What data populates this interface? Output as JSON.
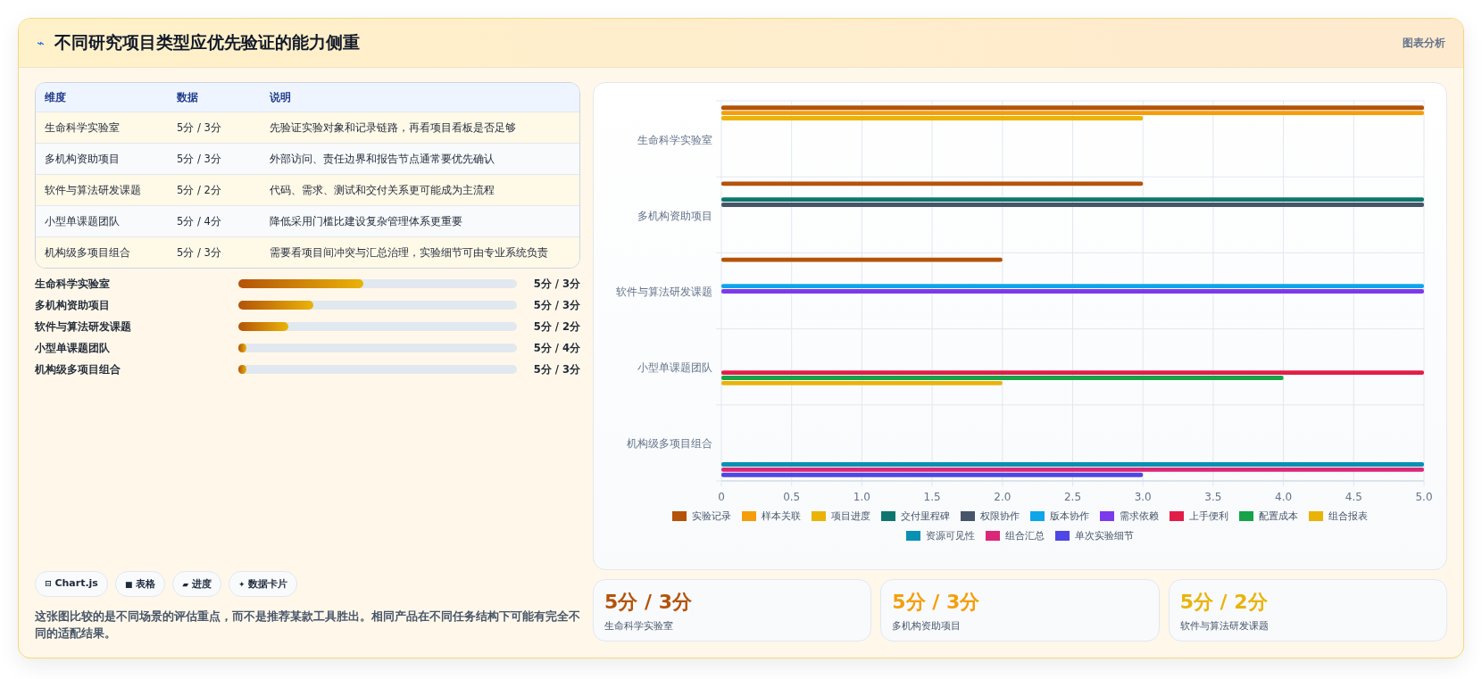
{
  "header": {
    "icon": "⌁",
    "title": "不同研究项目类型应优先验证的能力侧重",
    "tag": "图表分析"
  },
  "table": {
    "columns": [
      "维度",
      "数据",
      "说明"
    ],
    "rows": [
      [
        "生命科学实验室",
        "5分 / 3分",
        "先验证实验对象和记录链路，再看项目看板是否足够"
      ],
      [
        "多机构资助项目",
        "5分 / 3分",
        "外部访问、责任边界和报告节点通常要优先确认"
      ],
      [
        "软件与算法研发课题",
        "5分 / 2分",
        "代码、需求、测试和交付关系更可能成为主流程"
      ],
      [
        "小型单课题团队",
        "5分 / 4分",
        "降低采用门槛比建设复杂管理体系更重要"
      ],
      [
        "机构级多项目组合",
        "5分 / 3分",
        "需要看项目间冲突与汇总治理，实验细节可由专业系统负责"
      ]
    ]
  },
  "progress": [
    {
      "label": "生命科学实验室",
      "level": 0.45,
      "reading": "5分 / 3分"
    },
    {
      "label": "多机构资助项目",
      "level": 0.27,
      "reading": "5分 / 3分"
    },
    {
      "label": "软件与算法研发课题",
      "level": 0.18,
      "reading": "5分 / 2分"
    },
    {
      "label": "小型单课题团队",
      "level": 0.03,
      "reading": "5分 / 4分"
    },
    {
      "label": "机构级多项目组合",
      "level": 0.03,
      "reading": "5分 / 3分"
    }
  ],
  "chips": [
    {
      "icon": "⊟",
      "label": "Chart.js"
    },
    {
      "icon": "■",
      "label": "表格"
    },
    {
      "icon": "▰",
      "label": "进度"
    },
    {
      "icon": "✦",
      "label": "数据卡片"
    }
  ],
  "note": "这张图比较的是不同场景的评估重点，而不是推荐某款工具胜出。相同产品在不同任务结构下可能有完全不同的适配结果。",
  "chart": {
    "chart_data": {
      "type": "bar",
      "orientation": "horizontal",
      "categories": [
        "生命科学实验室",
        "多机构资助项目",
        "软件与算法研发课题",
        "小型单课题团队",
        "机构级多项目组合"
      ],
      "xlim": [
        0,
        5
      ],
      "grid": true,
      "xticks": [
        {
          "value": 0,
          "label": "0"
        },
        {
          "value": 0.5,
          "label": "0.5"
        },
        {
          "value": 1,
          "label": "1.0"
        },
        {
          "value": 1.5,
          "label": "1.5"
        },
        {
          "value": 2,
          "label": "2.0"
        },
        {
          "value": 2.5,
          "label": "2.5"
        },
        {
          "value": 3,
          "label": "3.0"
        },
        {
          "value": 3.5,
          "label": "3.5"
        },
        {
          "value": 4,
          "label": "4.0"
        },
        {
          "value": 4.5,
          "label": "4.5"
        },
        {
          "value": 5,
          "label": "5.0"
        }
      ],
      "series": [
        {
          "name": "实验记录",
          "color": "#b45309",
          "values": [
            5,
            3,
            2,
            null,
            null
          ]
        },
        {
          "name": "样本关联",
          "color": "#f59e0b",
          "values": [
            5,
            null,
            null,
            null,
            null
          ]
        },
        {
          "name": "项目进度",
          "color": "#eab308",
          "values": [
            3,
            null,
            null,
            null,
            null
          ]
        },
        {
          "name": "交付里程碑",
          "color": "#0f766e",
          "values": [
            null,
            5,
            null,
            null,
            null
          ]
        },
        {
          "name": "权限协作",
          "color": "#475569",
          "values": [
            null,
            5,
            null,
            null,
            null
          ]
        },
        {
          "name": "版本协作",
          "color": "#0ea5e9",
          "values": [
            null,
            null,
            5,
            null,
            null
          ]
        },
        {
          "name": "需求依赖",
          "color": "#7c3aed",
          "values": [
            null,
            null,
            5,
            null,
            null
          ]
        },
        {
          "name": "上手便利",
          "color": "#e11d48",
          "values": [
            null,
            null,
            null,
            5,
            null
          ]
        },
        {
          "name": "配置成本",
          "color": "#16a34a",
          "values": [
            null,
            null,
            null,
            4,
            null
          ]
        },
        {
          "name": "组合报表",
          "color": "#eab308",
          "values": [
            null,
            null,
            null,
            2,
            null
          ]
        },
        {
          "name": "资源可见性",
          "color": "#0891b2",
          "values": [
            null,
            null,
            null,
            null,
            5
          ]
        },
        {
          "name": "组合汇总",
          "color": "#db2777",
          "values": [
            null,
            null,
            null,
            null,
            5
          ]
        },
        {
          "name": "单次实验细节",
          "color": "#4f46e5",
          "values": [
            null,
            null,
            null,
            null,
            3
          ]
        }
      ]
    }
  },
  "stat_cards": [
    {
      "value": "5分 / 3分",
      "label": "生命科学实验室",
      "color": "#b45309"
    },
    {
      "value": "5分 / 3分",
      "label": "多机构资助项目",
      "color": "#f59e0b"
    },
    {
      "value": "5分 / 2分",
      "label": "软件与算法研发课题",
      "color": "#eab308"
    }
  ]
}
